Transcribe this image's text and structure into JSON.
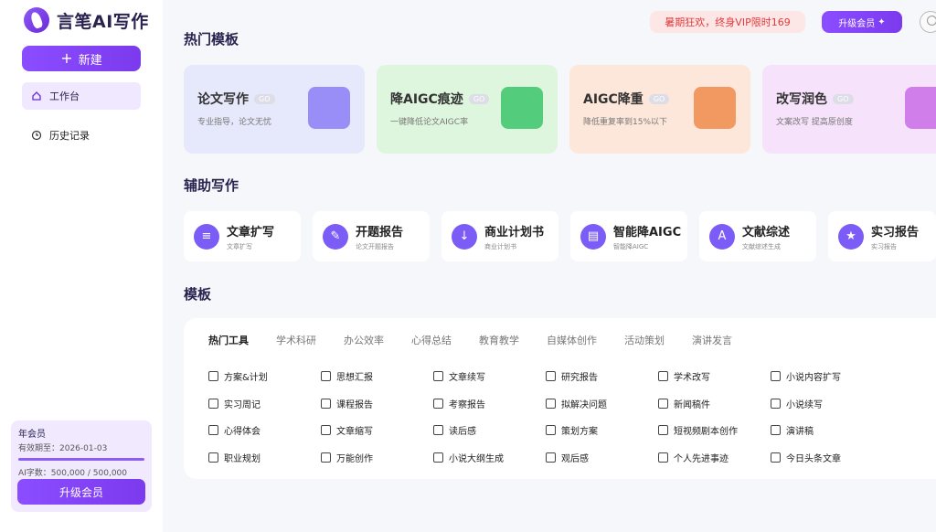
{
  "app": {
    "name": "言笔AI写作"
  },
  "sidebar": {
    "new_label": "新建",
    "items": [
      {
        "label": "工作台",
        "icon": "home-icon",
        "active": true
      },
      {
        "label": "历史记录",
        "icon": "clock-icon",
        "active": false
      }
    ],
    "member": {
      "title": "年会员",
      "expiry": "有效期至：2026-01-03",
      "ai_chars": "AI字数：500,000 / 500,000",
      "ai_chars_used_fraction": 1.0,
      "upgrade_label": "升级会员"
    }
  },
  "topbar": {
    "promo": "暑期狂欢，终身VIP限时169",
    "upgrade_label": "升级会员",
    "avatar_icon": "user-avatar-icon"
  },
  "hot": {
    "title": "热门模板",
    "go_label": "GO",
    "cards": [
      {
        "title": "论文写作",
        "sub": "专业指导，论文无忧",
        "bg": "#e6e8fb",
        "accent": "#8b7cf6"
      },
      {
        "title": "降AIGC痕迹",
        "sub": "一键降低论文AIGC率",
        "bg": "#dff6de",
        "accent": "#3bc46a"
      },
      {
        "title": "AIGC降重",
        "sub": "降低重复率到15%以下",
        "bg": "#fde6da",
        "accent": "#f08a4b"
      },
      {
        "title": "改写润色",
        "sub": "文案改写 提高原创度",
        "bg": "#f6e2fb",
        "accent": "#c86ce6"
      }
    ]
  },
  "assist": {
    "title": "辅助写作",
    "cards": [
      {
        "name": "文章扩写",
        "sub": "文章扩写",
        "icon": "expand-text-icon"
      },
      {
        "name": "开题报告",
        "sub": "论文开题报告",
        "icon": "pen-icon"
      },
      {
        "name": "商业计划书",
        "sub": "商业计划书",
        "icon": "document-download-icon"
      },
      {
        "name": "智能降AIGC",
        "sub": "智能降AIGC",
        "icon": "chat-icon"
      },
      {
        "name": "文献综述",
        "sub": "文献综述生成",
        "icon": "translate-icon"
      },
      {
        "name": "实习报告",
        "sub": "实习报告",
        "icon": "badge-icon"
      }
    ]
  },
  "templates": {
    "title": "模板",
    "tabs": [
      "热门工具",
      "学术科研",
      "办公效率",
      "心得总结",
      "教育教学",
      "自媒体创作",
      "活动策划",
      "演讲发言"
    ],
    "tools": [
      [
        "方案&计划",
        "思想汇报",
        "文章续写",
        "研究报告",
        "学术改写",
        "小说内容扩写"
      ],
      [
        "实习周记",
        "课程报告",
        "考察报告",
        "拟解决问题",
        "新闻稿件",
        "小说续写"
      ],
      [
        "心得体会",
        "文章缩写",
        "读后感",
        "策划方案",
        "短视频剧本创作",
        "演讲稿"
      ],
      [
        "职业规划",
        "万能创作",
        "小说大纲生成",
        "观后感",
        "个人先进事迹",
        "今日头条文章"
      ]
    ]
  }
}
